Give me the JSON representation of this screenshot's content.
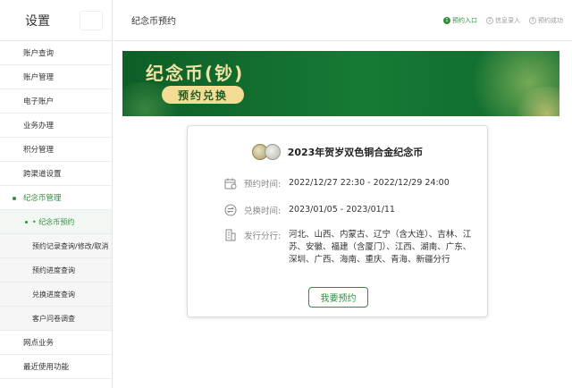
{
  "sidebar": {
    "title": "设置",
    "items": [
      {
        "label": "账户查询"
      },
      {
        "label": "账户管理"
      },
      {
        "label": "电子账户"
      },
      {
        "label": "业务办理"
      },
      {
        "label": "积分管理"
      },
      {
        "label": "跨渠道设置"
      },
      {
        "label": "纪念币管理"
      }
    ],
    "subitems": [
      {
        "label": "• 纪念币预约"
      },
      {
        "label": "预约记录查询/修改/取消"
      },
      {
        "label": "预约进度查询"
      },
      {
        "label": "兑换进度查询"
      },
      {
        "label": "客户问卷调查"
      }
    ],
    "bottom_items": [
      {
        "label": "网点业务"
      },
      {
        "label": "最近使用功能"
      }
    ]
  },
  "header": {
    "title": "纪念币预约",
    "steps": [
      {
        "num": "1",
        "label": "预约入口"
      },
      {
        "num": "2",
        "label": "信息录入"
      },
      {
        "num": "3",
        "label": "预约成功"
      }
    ]
  },
  "banner": {
    "title": "纪念币(钞)",
    "pill": "预约兑换"
  },
  "card": {
    "title": "2023年贺岁双色铜合金纪念币",
    "reserve_label": "预约时间:",
    "reserve_value": "2022/12/27 22:30 - 2022/12/29 24:00",
    "exchange_label": "兑换时间:",
    "exchange_value": "2023/01/05 - 2023/01/11",
    "branch_label": "发行分行:",
    "branch_value": "河北、山西、内蒙古、辽宁（含大连）、吉林、江苏、安徽、福建（含厦门）、江西、湖南、广东、深圳、广西、海南、重庆、青海、新疆分行",
    "button": "我要预约"
  },
  "colors": {
    "brand_green": "#2f8f3f",
    "banner_green": "#167a34",
    "gold": "#f2e2a6"
  }
}
